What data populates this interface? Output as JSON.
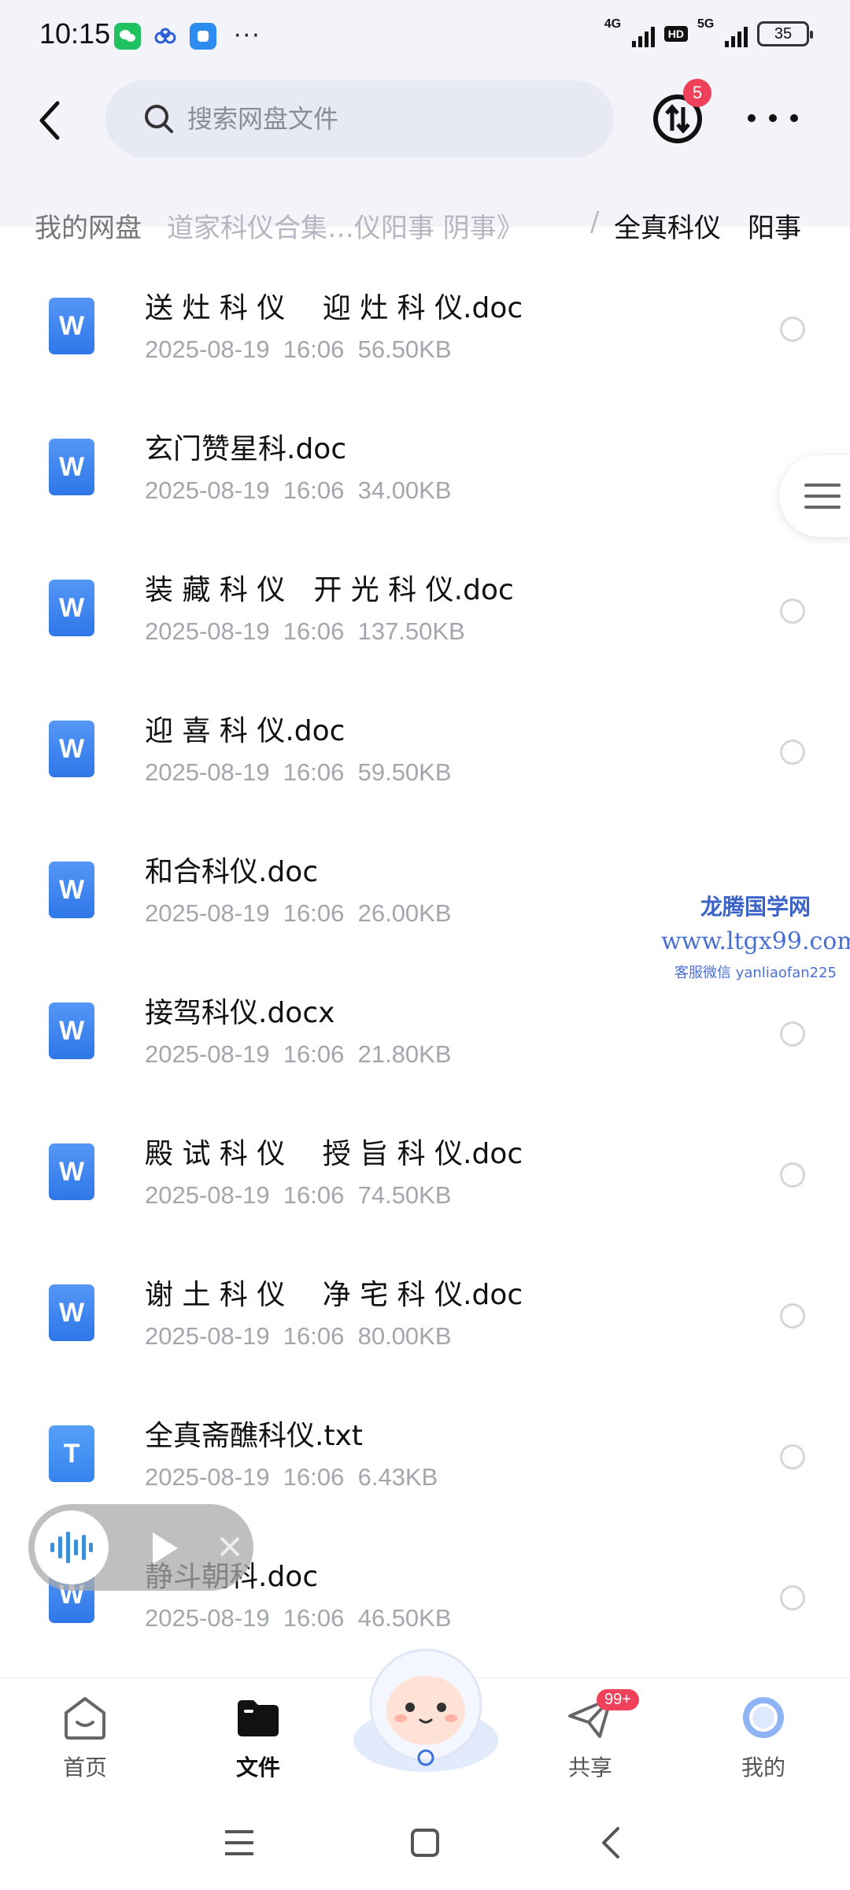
{
  "status_bar": {
    "time": "10:15",
    "network_1": "4G",
    "hd": "HD",
    "network_2": "5G",
    "battery": "35"
  },
  "header": {
    "search_placeholder": "搜索网盘文件",
    "transfer_badge": "5"
  },
  "breadcrumb": {
    "root": "我的网盘",
    "middle": "道家科仪合集…仪阳事 阴事》",
    "separator": "/",
    "current": "全真科仪　阳事"
  },
  "files": [
    {
      "name": "送 灶 科 仪　 迎 灶 科 仪.doc",
      "meta": "2025-08-19  16:06  56.50KB",
      "icon": "word-doc-icon"
    },
    {
      "name": "玄门赞星科.doc",
      "meta": "2025-08-19  16:06  34.00KB",
      "icon": "word-doc-icon"
    },
    {
      "name": "装 藏 科 仪　开 光 科 仪.doc",
      "meta": "2025-08-19  16:06  137.50KB",
      "icon": "word-doc-icon"
    },
    {
      "name": "迎 喜 科 仪.doc",
      "meta": "2025-08-19  16:06  59.50KB",
      "icon": "word-doc-icon"
    },
    {
      "name": "和合科仪.doc",
      "meta": "2025-08-19  16:06  26.00KB",
      "icon": "word-doc-icon"
    },
    {
      "name": "接驾科仪.docx",
      "meta": "2025-08-19  16:06  21.80KB",
      "icon": "word-doc-icon"
    },
    {
      "name": "殿 试 科 仪　 授 旨 科 仪.doc",
      "meta": "2025-08-19  16:06  74.50KB",
      "icon": "word-doc-icon"
    },
    {
      "name": "谢 土 科 仪　 净 宅 科 仪.doc",
      "meta": "2025-08-19  16:06  80.00KB",
      "icon": "word-doc-icon"
    },
    {
      "name": "全真斋醮科仪.txt",
      "meta": "2025-08-19  16:06  6.43KB",
      "icon": "text-file-icon"
    },
    {
      "name": "静斗朝科.doc",
      "meta": "2025-08-19  16:06  46.50KB",
      "icon": "word-doc-icon"
    }
  ],
  "watermark": {
    "title": "龙腾国学网",
    "url": "www.ltgx99.com",
    "contact": "客服微信 yanliaofan225"
  },
  "bottom_nav": {
    "home": "首页",
    "files": "文件",
    "share": "共享",
    "share_badge": "99+",
    "me": "我的"
  },
  "colors": {
    "accent_blue": "#2f77e8",
    "badge_red": "#f0415a",
    "header_bg": "#f2f4fa"
  }
}
